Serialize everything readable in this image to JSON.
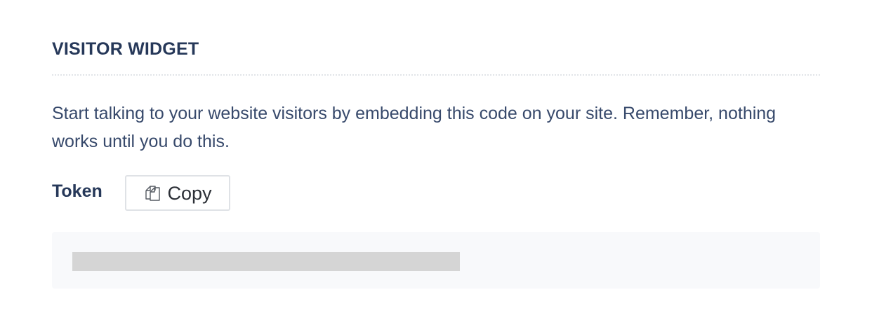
{
  "visitor_widget": {
    "title": "VISITOR WIDGET",
    "description": "Start talking to your website visitors by embedding this code on your site. Remember, nothing works until you do this.",
    "token_label": "Token",
    "copy_button": {
      "label": "Copy",
      "icon": "copy-icon"
    },
    "token_value": ""
  },
  "colors": {
    "heading": "#263859",
    "body_text": "#37496b",
    "token_box_bg": "#f8f9fb",
    "redaction": "#d5d5d5",
    "button_border": "#dfe2e6"
  }
}
